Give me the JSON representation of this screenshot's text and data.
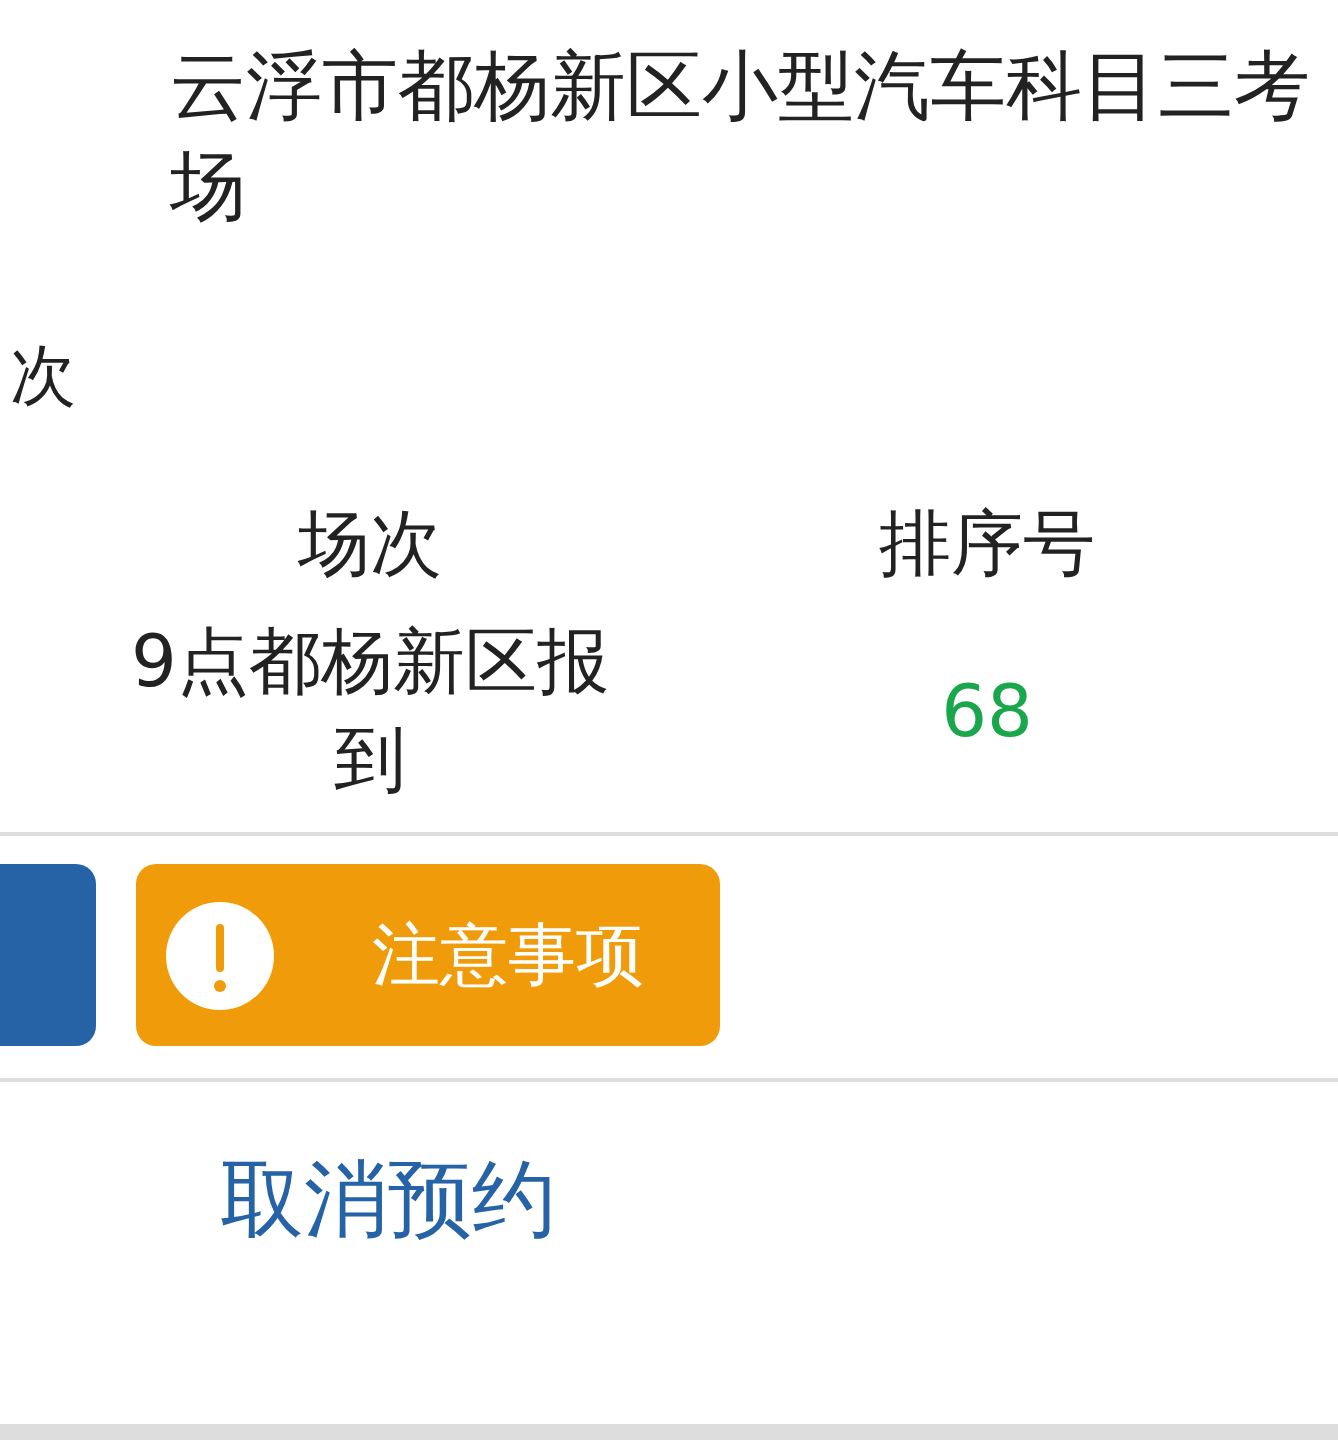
{
  "venue": {
    "title": "云浮市都杨新区小型汽车科目三考场"
  },
  "field_label": "次",
  "table": {
    "columns": [
      "场次",
      "排序号"
    ],
    "rows": [
      {
        "cells": [
          "9点都杨新区报到",
          "68"
        ]
      }
    ]
  },
  "actions": [
    {
      "kind": "cut"
    },
    {
      "kind": "notice",
      "label": "注意事项"
    }
  ],
  "cancel_link": "取消预约"
}
